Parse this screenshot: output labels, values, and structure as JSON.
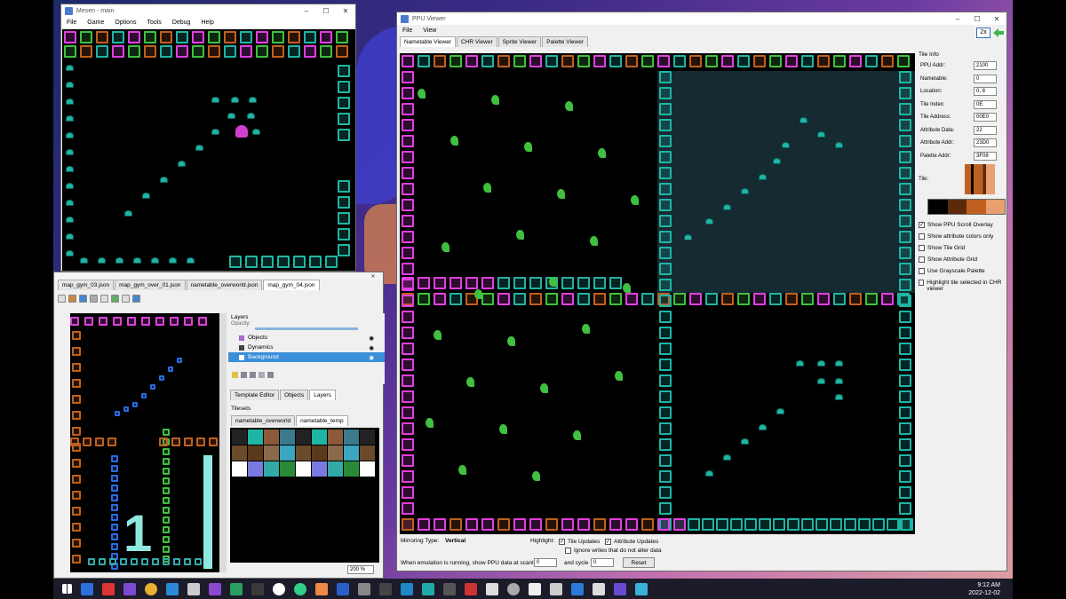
{
  "mesen": {
    "title": "Mesen - main",
    "menu": [
      "File",
      "Game",
      "Options",
      "Tools",
      "Debug",
      "Help"
    ]
  },
  "tiled": {
    "tabs": [
      "map_gym_03.json",
      "map_gym_over_01.json",
      "nametable_overworld.json",
      "map_gym_04.json"
    ],
    "layers_title": "Layers",
    "opacity_label": "Opacity:",
    "layers": [
      "Objects",
      "Dynamics",
      "Background"
    ],
    "panel_tabs": [
      "Template Editor",
      "Objects",
      "Layers"
    ],
    "tilesets_title": "Tilesets",
    "tileset_tabs": [
      "nametable_overworld",
      "nametable_temp"
    ],
    "zoom": "200 %",
    "big_digit": "1"
  },
  "ppu": {
    "title": "PPU Viewer",
    "menu": [
      "File",
      "View"
    ],
    "tabs": [
      "Nametable Viewer",
      "CHR Viewer",
      "Sprite Viewer",
      "Palette Viewer"
    ],
    "zoom_btn": "2x",
    "tile_info_title": "Tile Info",
    "fields": [
      {
        "label": "PPU Addr:",
        "value": "2100"
      },
      {
        "label": "Nametable:",
        "value": "0"
      },
      {
        "label": "Location:",
        "value": "0, 8"
      },
      {
        "label": "Tile Index:",
        "value": "0E"
      },
      {
        "label": "Tile Address:",
        "value": "00E0"
      },
      {
        "label": "Attribute Data:",
        "value": "22"
      },
      {
        "label": "Attribute Addr:",
        "value": "23D0"
      },
      {
        "label": "Palette Addr:",
        "value": "3F08"
      }
    ],
    "tile_label": "Tile:",
    "options": [
      {
        "label": "Show PPU Scroll Overlay",
        "checked": true
      },
      {
        "label": "Show attribute colors only",
        "checked": false
      },
      {
        "label": "Show Tile Grid",
        "checked": false
      },
      {
        "label": "Show Attribute Grid",
        "checked": false
      },
      {
        "label": "Use Grayscale Palette",
        "checked": false
      },
      {
        "label": "Highlight tile selected in CHR viewer",
        "checked": false
      }
    ],
    "mirroring_label": "Mirroring Type:",
    "mirroring_value": "Vertical",
    "highlight_label": "Highlight:",
    "tile_updates": "Tile Updates",
    "attribute_updates": "Attribute Updates",
    "ignore_writes": "Ignore writes that do not alter data",
    "scanline_label": "When emulation is running, show PPU data at scanline",
    "scanline_value": "0",
    "cycle_label": "and cycle",
    "cycle_value": "0",
    "reset": "Reset"
  },
  "palette": [
    "#e040e0",
    "#1fb5a5",
    "#c06020",
    "#40c040",
    "#000000"
  ],
  "clock": {
    "time": "9:12 AM",
    "date": "2022-12-02"
  }
}
